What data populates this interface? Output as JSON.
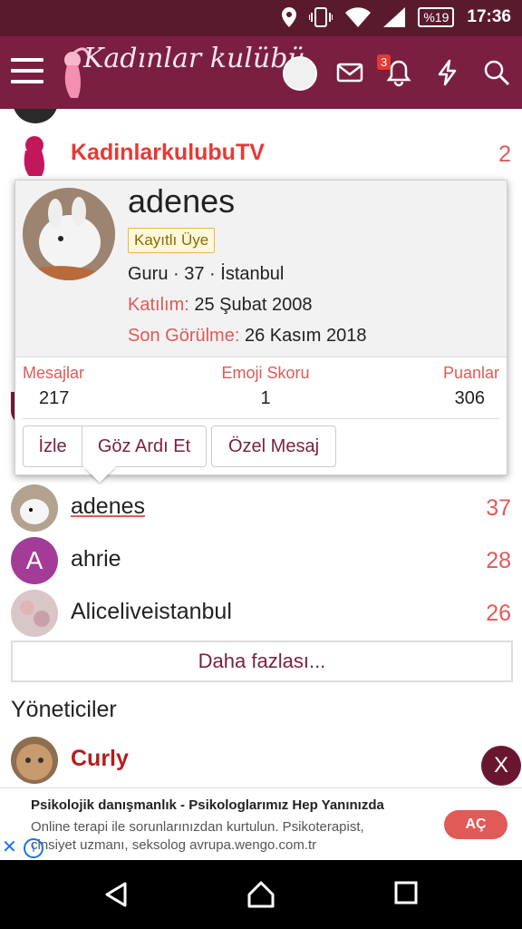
{
  "status_bar": {
    "battery": "%19",
    "time": "17:36"
  },
  "app": {
    "logo_text": "Kadınlar kulübü",
    "notification_count": "3"
  },
  "list_top": [
    {
      "name": "KadinlarkulubuTV",
      "count": "2"
    }
  ],
  "list_bottom": [
    {
      "name": "adenes",
      "count": "37"
    },
    {
      "name": "ahrie",
      "count": "28",
      "initial": "A"
    },
    {
      "name": "Aliceliveistanbul",
      "count": "26"
    }
  ],
  "more_button": "Daha fazlası...",
  "admins_title": "Yöneticiler",
  "admins": [
    {
      "name": "Curly"
    }
  ],
  "popup": {
    "username": "adenes",
    "role": "Kayıtlı Üye",
    "info": "Guru · 37 · İstanbul",
    "joined_label": "Katılım:",
    "joined_value": "25 Şubat 2008",
    "last_seen_label": "Son Görülme:",
    "last_seen_value": "26 Kasım 2018",
    "stats": [
      {
        "label": "Mesajlar",
        "value": "217"
      },
      {
        "label": "Emoji Skoru",
        "value": "1"
      },
      {
        "label": "Puanlar",
        "value": "306"
      }
    ],
    "buttons": {
      "follow": "İzle",
      "ignore": "Göz Ardı Et",
      "message": "Özel Mesaj"
    }
  },
  "close_button": "X",
  "ad": {
    "title": "Psikolojik danışmanlık - Psikologlarımız Hep Yanınızda",
    "text": "Online terapi ile sorunlarınızdan kurtulun. Psikoterapist, cinsiyet uzmanı, seksolog avrupa.wengo.com.tr",
    "open_label": "AÇ"
  },
  "colors": {
    "brand": "#7a1f3f",
    "status_bar": "#5a1a2e",
    "accent_red": "#e05a57",
    "name_red": "#e53935",
    "name_dark_red": "#b71c1c"
  }
}
